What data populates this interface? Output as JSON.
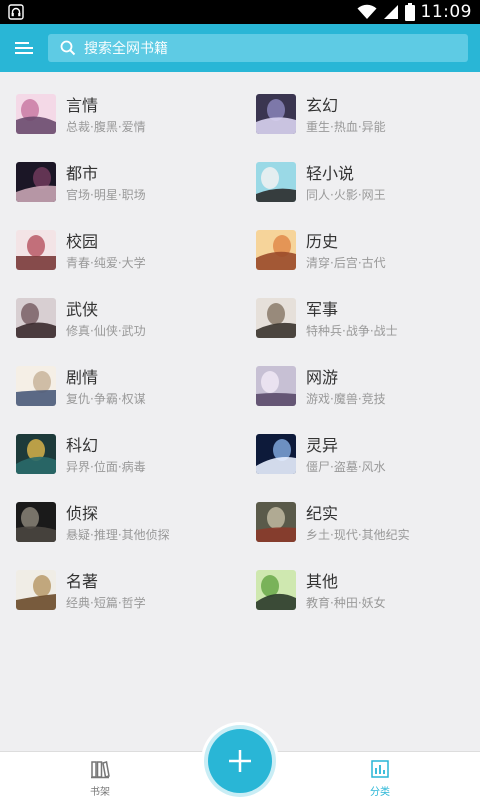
{
  "status_bar": {
    "time": "11:09",
    "battery_level": "full"
  },
  "header": {
    "search_placeholder": "搜索全网书籍"
  },
  "categories": [
    {
      "title": "言情",
      "tags": "总裁·腹黑·爱情",
      "colors": [
        "#f4d9e7",
        "#c97aa3",
        "#6a4a6e"
      ]
    },
    {
      "title": "玄幻",
      "tags": "重生·热血·异能",
      "colors": [
        "#3a3550",
        "#8a84b8",
        "#d9d3f0"
      ]
    },
    {
      "title": "都市",
      "tags": "官场·明星·职场",
      "colors": [
        "#1b1626",
        "#6e3a5c",
        "#c8a4b4"
      ]
    },
    {
      "title": "轻小说",
      "tags": "同人·火影·网王",
      "colors": [
        "#9ad9e6",
        "#f1f1f1",
        "#2b2b2b"
      ]
    },
    {
      "title": "校园",
      "tags": "青春·纯爱·大学",
      "colors": [
        "#f3e4e6",
        "#b85a66",
        "#7a3a3a"
      ]
    },
    {
      "title": "历史",
      "tags": "清穿·后宫·古代",
      "colors": [
        "#f6d49a",
        "#e08a4a",
        "#9a4a2a"
      ]
    },
    {
      "title": "武侠",
      "tags": "修真·仙侠·武功",
      "colors": [
        "#d8cfd2",
        "#7a6066",
        "#3b2a2e"
      ]
    },
    {
      "title": "军事",
      "tags": "特种兵·战争·战士",
      "colors": [
        "#e6e0da",
        "#8a7a6a",
        "#3a342e"
      ]
    },
    {
      "title": "剧情",
      "tags": "复仇·争霸·权谋",
      "colors": [
        "#f5efe6",
        "#c8b49a",
        "#4a5a7a"
      ]
    },
    {
      "title": "网游",
      "tags": "游戏·魔兽·竞技",
      "colors": [
        "#c7c0d4",
        "#f0e8f4",
        "#5a4a6a"
      ]
    },
    {
      "title": "科幻",
      "tags": "异界·位面·病毒",
      "colors": [
        "#1d3a3a",
        "#d6b24a",
        "#2a6a6a"
      ]
    },
    {
      "title": "灵异",
      "tags": "僵尸·盗墓·风水",
      "colors": [
        "#0d1a3a",
        "#7fa6d9",
        "#e8f0ff"
      ]
    },
    {
      "title": "侦探",
      "tags": "悬疑·推理·其他侦探",
      "colors": [
        "#1a1a1a",
        "#8a8478",
        "#4a4640"
      ]
    },
    {
      "title": "纪实",
      "tags": "乡土·现代·其他纪实",
      "colors": [
        "#5a5a4a",
        "#c0b8a0",
        "#8a3a2a"
      ]
    },
    {
      "title": "名著",
      "tags": "经典·短篇·哲学",
      "colors": [
        "#f0ede6",
        "#b89a6a",
        "#6a4a2a"
      ]
    },
    {
      "title": "其他",
      "tags": "教育·种田·妖女",
      "colors": [
        "#cfe8b0",
        "#6aa84a",
        "#2a3a2a"
      ]
    }
  ],
  "bottom_nav": {
    "shelf_label": "书架",
    "category_label": "分类",
    "active": "分类"
  },
  "colors": {
    "accent": "#29b6d6",
    "background": "#efeff1",
    "title_text": "#333333",
    "tag_text": "#999999"
  },
  "icons": {
    "menu": "hamburger-icon",
    "search": "search-icon",
    "fab": "plus-icon",
    "shelf": "bookshelf-icon",
    "category": "bar-chart-icon"
  }
}
